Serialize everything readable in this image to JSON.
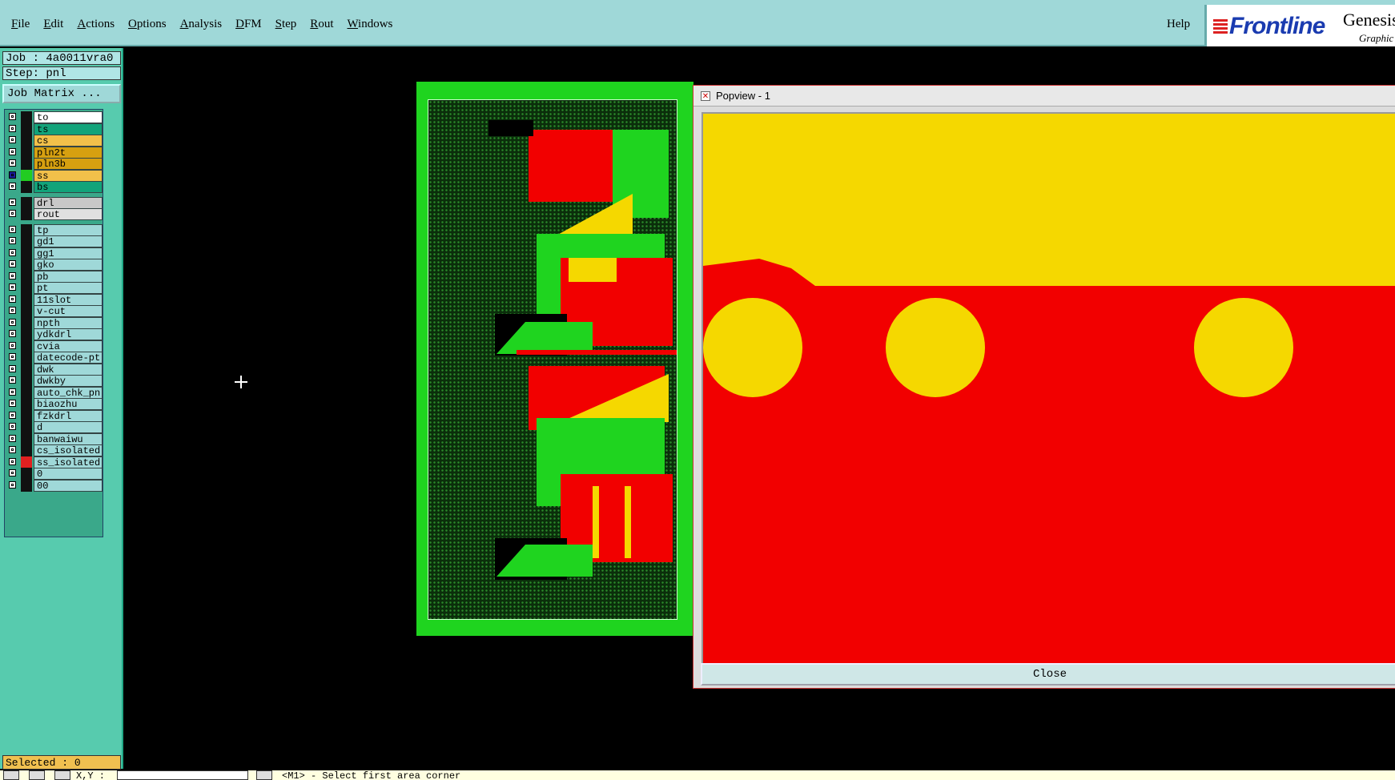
{
  "menubar": {
    "items": [
      "File",
      "Edit",
      "Actions",
      "Options",
      "Analysis",
      "DFM",
      "Step",
      "Rout",
      "Windows"
    ],
    "help": "Help",
    "brand": "Frontline",
    "product": "Genesis",
    "product_sub": "Graphic"
  },
  "sidebar": {
    "job": "Job : 4a0011vra0",
    "step": "Step: pnl",
    "matrix_button": "Job Matrix ...",
    "layers": [
      {
        "name": "to",
        "color": "#ffffff",
        "swatch": "#111111",
        "checked": false
      },
      {
        "name": "ts",
        "color": "#12a37a",
        "swatch": "#111111",
        "checked": false
      },
      {
        "name": "cs",
        "color": "#f2c04a",
        "swatch": "#111111",
        "checked": false
      },
      {
        "name": "pln2t",
        "color": "#d6a010",
        "swatch": "#111111",
        "checked": false
      },
      {
        "name": "pln3b",
        "color": "#d6a010",
        "swatch": "#111111",
        "checked": false
      },
      {
        "name": "ss",
        "color": "#f2c04a",
        "swatch": "#22cc22",
        "checked": true
      },
      {
        "name": "bs",
        "color": "#12a37a",
        "swatch": "#111111",
        "checked": false
      },
      {
        "name": "drl",
        "color": "#c8c8c8",
        "swatch": "#111111",
        "checked": false
      },
      {
        "name": "rout",
        "color": "#e0e0e0",
        "swatch": "#111111",
        "checked": false
      },
      {
        "name": "tp",
        "color": "#9fd8d8",
        "swatch": "#111111",
        "checked": false
      },
      {
        "name": "gd1",
        "color": "#9fd8d8",
        "swatch": "#111111",
        "checked": false
      },
      {
        "name": "gg1",
        "color": "#9fd8d8",
        "swatch": "#111111",
        "checked": false
      },
      {
        "name": "gko",
        "color": "#9fd8d8",
        "swatch": "#111111",
        "checked": false
      },
      {
        "name": "pb",
        "color": "#9fd8d8",
        "swatch": "#111111",
        "checked": false
      },
      {
        "name": "pt",
        "color": "#9fd8d8",
        "swatch": "#111111",
        "checked": false
      },
      {
        "name": "11slot",
        "color": "#9fd8d8",
        "swatch": "#111111",
        "checked": false
      },
      {
        "name": "v-cut",
        "color": "#9fd8d8",
        "swatch": "#111111",
        "checked": false
      },
      {
        "name": "npth",
        "color": "#9fd8d8",
        "swatch": "#111111",
        "checked": false
      },
      {
        "name": "ydkdrl",
        "color": "#9fd8d8",
        "swatch": "#111111",
        "checked": false
      },
      {
        "name": "cvia",
        "color": "#9fd8d8",
        "swatch": "#111111",
        "checked": false
      },
      {
        "name": "datecode-pt",
        "color": "#9fd8d8",
        "swatch": "#111111",
        "checked": false
      },
      {
        "name": "dwk",
        "color": "#9fd8d8",
        "swatch": "#111111",
        "checked": false
      },
      {
        "name": "dwkby",
        "color": "#9fd8d8",
        "swatch": "#111111",
        "checked": false
      },
      {
        "name": "auto_chk_pnl",
        "color": "#9fd8d8",
        "swatch": "#111111",
        "checked": false
      },
      {
        "name": "biaozhu",
        "color": "#9fd8d8",
        "swatch": "#111111",
        "checked": false
      },
      {
        "name": "fzkdrl",
        "color": "#9fd8d8",
        "swatch": "#111111",
        "checked": false
      },
      {
        "name": "d",
        "color": "#9fd8d8",
        "swatch": "#111111",
        "checked": false
      },
      {
        "name": "banwaiwu",
        "color": "#9fd8d8",
        "swatch": "#111111",
        "checked": false
      },
      {
        "name": "cs_isolated",
        "color": "#9fd8d8",
        "swatch": "#111111",
        "checked": false
      },
      {
        "name": "ss_isolated",
        "color": "#9fd8d8",
        "swatch": "#e02020",
        "checked": false
      },
      {
        "name": "0",
        "color": "#9fd8d8",
        "swatch": "#111111",
        "checked": false
      },
      {
        "name": "00",
        "color": "#9fd8d8",
        "swatch": "#111111",
        "checked": false
      }
    ],
    "selected": "Selected : 0"
  },
  "popview": {
    "title": "Popview - 1",
    "close_label": "Close",
    "colors": {
      "copper": "#f5d800",
      "background": "#f20000"
    }
  },
  "statusbar": {
    "xy_label": "X,Y :",
    "message": "<M1> - Select first area corner"
  },
  "colors": {
    "menubar": "#9fd8d8",
    "sidebar": "#57cbae",
    "board": "#1fd41f"
  }
}
